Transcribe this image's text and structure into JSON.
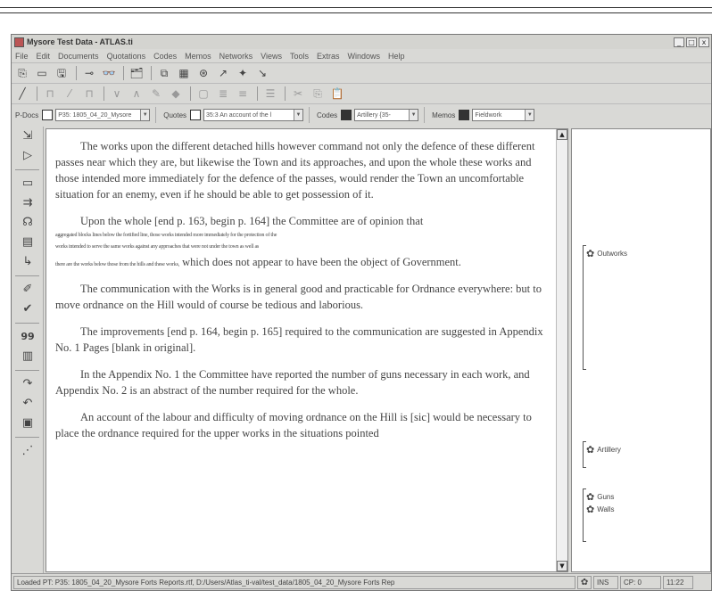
{
  "window": {
    "title": "Mysore Test Data - ATLAS.ti",
    "controls": [
      "_",
      "□",
      "x"
    ]
  },
  "menubar": [
    "File",
    "Edit",
    "Documents",
    "Quotations",
    "Codes",
    "Memos",
    "Networks",
    "Views",
    "Tools",
    "Extras",
    "Windows",
    "Help"
  ],
  "toolbar1": [
    "⎘",
    "▭",
    "🖫",
    "⊸",
    "👓",
    "🗂",
    "⧉",
    "▦",
    "⊛",
    "↗",
    "✦",
    "↘"
  ],
  "toolbar2": [
    "╱",
    "⊓",
    "⁄",
    "⊓",
    "∨",
    "∧",
    "✎",
    "◆",
    "▢",
    "≣",
    "≡",
    "☰",
    "✂",
    "⎘",
    "📋"
  ],
  "selectors": {
    "pdocs": {
      "label": "P-Docs",
      "value": "P35: 1805_04_20_Mysore"
    },
    "quotes": {
      "label": "Quotes",
      "value": "35:3 An account of the l"
    },
    "codes": {
      "label": "Codes",
      "value": "Artillery {35-"
    },
    "memos": {
      "label": "Memos",
      "value": "Fieldwork"
    }
  },
  "left_tools": [
    "⇲",
    "▷",
    "▭",
    "⇉",
    "☊",
    "▤",
    "↳",
    "✐",
    "✔",
    "99",
    "▥",
    "↷",
    "↶",
    "▣",
    "⋰"
  ],
  "document": {
    "paragraphs": [
      "The works upon the different detached hills however command not only the defence of these different passes near which they are, but likewise the Town and its approaches, and upon the whole these works and those intended more immediately for the defence of the passes, would render the Town an uncomfortable situation for an enemy, even if he should be able to get possession of it.",
      "Upon the whole [end p. 163, begin p. 164] the Committee are of opinion that",
      "The communication with the Works is in general good and practicable for Ordnance everywhere: but to move ordnance on the Hill would of course be tedious and laborious.",
      "The improvements [end p. 164, begin p. 165] required to the communication are suggested in Appendix No. 1 Pages [blank in original].",
      "In the Appendix No. 1 the Committee have reported the number of guns necessary in each work, and Appendix No. 2 is an abstract of the number required for the whole.",
      "An account of the labour and difficulty of moving ordnance on the Hill is [sic] would be necessary to place the ordnance required for the upper works in the situations pointed"
    ],
    "garbled": [
      "aggregated blocks lines below the fortified line, those works intended more immediately for the protection of the",
      "works intended to serve the same works against any approaches that were not under the town as well as",
      "there are the works below those from the hills and these works,"
    ],
    "garbled_tail": "which does not appear to have been the object of Government."
  },
  "margin_codes": [
    {
      "icon": "✿",
      "label": "Outworks"
    },
    {
      "icon": "✿",
      "label": "Artillery"
    },
    {
      "icon": "✿",
      "label": "Guns"
    },
    {
      "icon": "✿",
      "label": "Walls"
    }
  ],
  "statusbar": {
    "path": "Loaded PT: P35: 1805_04_20_Mysore Forts Reports.rtf, D:/Users/Atlas_ti-val/test_data/1805_04_20_Mysore Forts Rep",
    "code_icon": "✿",
    "mode": "INS",
    "position": "CP: 0",
    "time": "11:22"
  }
}
